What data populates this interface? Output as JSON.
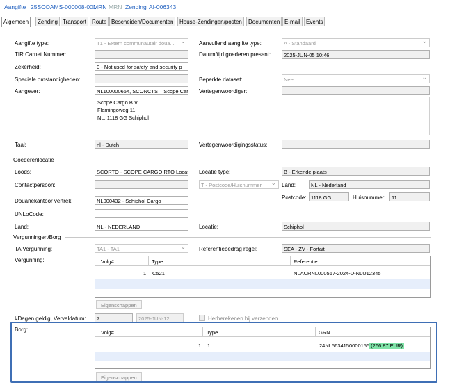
{
  "header": {
    "aangifte_label": "Aangifte",
    "aangifte_value": "25SCOAMS-000008-001",
    "mrn_label": "MRN",
    "mrn_value": "MRN",
    "zending_label": "Zending",
    "zending_value": "AI-006343"
  },
  "tabs": [
    "Algemeen",
    "Zending",
    "Transport",
    "Route",
    "Bescheiden/Documenten",
    "House-Zendingen/posten",
    "Documenten",
    "E-mail",
    "Events"
  ],
  "form": {
    "aangifte_type_label": "Aangifte type:",
    "aangifte_type_value": "T1 - Extern communautair doua...",
    "aanvullend_label": "Aanvullend aangifte type:",
    "aanvullend_value": "A - Standaard",
    "tir_label": "TIR Carnet Nummer:",
    "tir_value": "",
    "datum_label": "Datum/tijd goederen present:",
    "datum_value": "2025-JUN-05 10:46",
    "zekerheid_label": "Zekerheid:",
    "zekerheid_value": "0 - Not used for safety and security p",
    "speciale_label": "Speciale omstandigheden:",
    "speciale_value": "",
    "beperkte_label": "Beperkte dataset:",
    "beperkte_value": "Nee",
    "aangever_label": "Aangever:",
    "aangever_value": "NL100000654, SCONCTS – Scope Car",
    "vertegenwoordiger_label": "Vertegenwoordiger:",
    "vertegenwoordiger_value": "",
    "address_line1": "Scope Cargo B.V.",
    "address_line2": "Flamingoweg 11",
    "address_line3": "NL, 1118 GG Schiphol",
    "taal_label": "Taal:",
    "taal_value": "nl - Dutch",
    "vert_status_label": "Vertegenwoordigingsstatus:",
    "vert_status_value": ""
  },
  "goederenlocatie": {
    "section_title": "Goederenlocatie",
    "loods_label": "Loods:",
    "loods_value": "SCORTO - SCOPE CARGO RTO Locat",
    "locatie_type_label": "Locatie type:",
    "locatie_type_value": "B - Erkende plaats",
    "contact_label": "Contactpersoon:",
    "contact_value": "",
    "postcode_type_value": "T - Postcode/Huisnummer",
    "land_label": "Land:",
    "land_value": "NL - Nederland",
    "douanekantoor_label": "Douanekantoor vertrek:",
    "douanekantoor_value": "NL000432 - Schiphol Cargo",
    "postcode_label": "Postcode:",
    "postcode_value": "1118 GG",
    "huisnummer_label": "Huisnummer:",
    "huisnummer_value": "11",
    "unlocode_label": "UNLoCode:",
    "unlocode_value": "",
    "land2_label": "Land:",
    "land2_value": "NL - NEDERLAND",
    "locatie_label": "Locatie:",
    "locatie_value": "Schiphol"
  },
  "vergunningen": {
    "section_title": "Vergunningen/Borg",
    "ta_label": "TA Vergunning:",
    "ta_value": "TA1 - TA1",
    "referentiebedrag_label": "Referentiebedrag regel:",
    "referentiebedrag_value": "SEA - ZV - Forfait",
    "vergunning_label": "Vergunning:",
    "columns": [
      "Volg#",
      "Type",
      "Referentie"
    ],
    "rows": [
      [
        "1",
        "C521",
        "NLACRNL000567-2024-D-NLU12345"
      ]
    ],
    "eigenschappen_label": "Eigenschappen",
    "dagen_label": "#Dagen geldig, Vervaldatum:",
    "dagen_value": "7",
    "vervaldatum_value": "2025-JUN-12",
    "herberekenen_label": "Herberekenen bij verzenden"
  },
  "borg": {
    "label": "Borg:",
    "columns": [
      "Volg#",
      "Type",
      "GRN"
    ],
    "row_volg": "1",
    "row_type": "1",
    "row_grn": "24NL5634150000155",
    "row_amount": "(266.87 EUR)",
    "eigenschappen_label": "Eigenschappen"
  }
}
